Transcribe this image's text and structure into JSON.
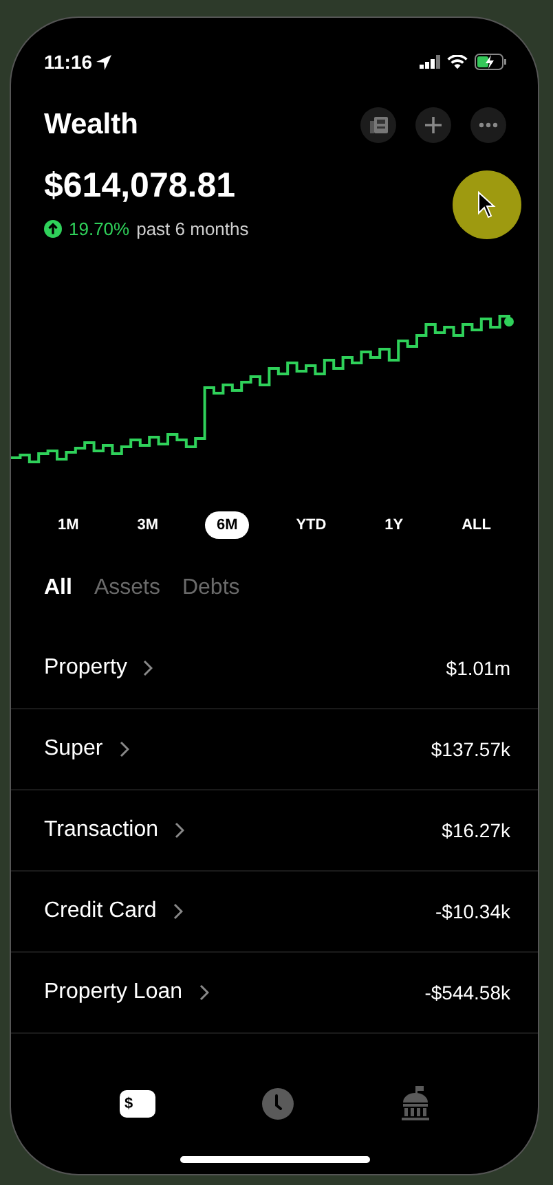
{
  "status_bar": {
    "time": "11:16"
  },
  "header": {
    "title": "Wealth",
    "total": "$614,078.81",
    "change": "19.70%",
    "change_period": "past 6 months"
  },
  "periods": [
    {
      "label": "1M",
      "selected": false
    },
    {
      "label": "3M",
      "selected": false
    },
    {
      "label": "6M",
      "selected": true
    },
    {
      "label": "YTD",
      "selected": false
    },
    {
      "label": "1Y",
      "selected": false
    },
    {
      "label": "ALL",
      "selected": false
    }
  ],
  "filters": [
    {
      "label": "All",
      "selected": true
    },
    {
      "label": "Assets",
      "selected": false
    },
    {
      "label": "Debts",
      "selected": false
    }
  ],
  "accounts": [
    {
      "name": "Property",
      "value": "$1.01m"
    },
    {
      "name": "Super",
      "value": "$137.57k"
    },
    {
      "name": "Transaction",
      "value": "$16.27k"
    },
    {
      "name": "Credit Card",
      "value": "-$10.34k"
    },
    {
      "name": "Property Loan",
      "value": "-$544.58k"
    }
  ],
  "tab_bar": [
    {
      "kind": "money",
      "symbol": "$",
      "selected": true
    },
    {
      "kind": "clock",
      "selected": false
    },
    {
      "kind": "bank",
      "selected": false
    }
  ]
}
